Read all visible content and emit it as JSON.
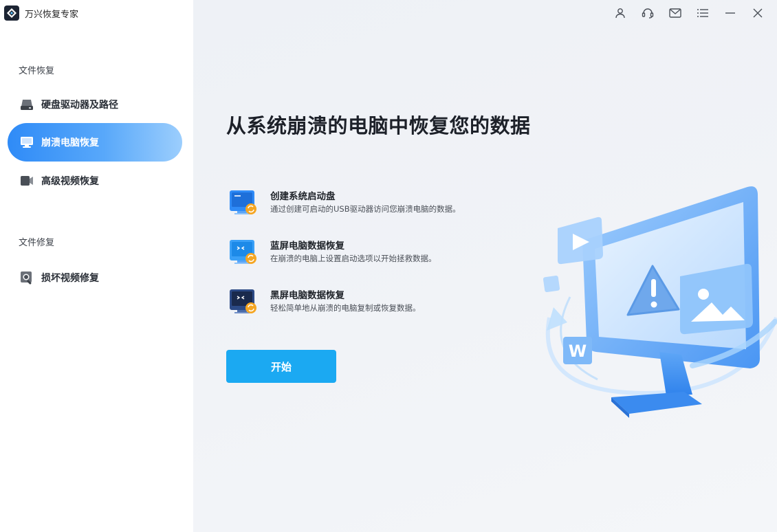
{
  "app": {
    "title": "万兴恢复专家"
  },
  "sidebar": {
    "sections": [
      {
        "label": "文件恢复",
        "items": [
          {
            "label": "硬盘驱动器及路径",
            "icon": "hard-drive-icon"
          },
          {
            "label": "崩溃电脑恢复",
            "icon": "monitor-icon",
            "active": true
          },
          {
            "label": "高级视频恢复",
            "icon": "video-camera-icon"
          }
        ]
      },
      {
        "label": "文件修复",
        "items": [
          {
            "label": "损坏视频修复",
            "icon": "video-repair-icon"
          }
        ]
      }
    ]
  },
  "window_controls": [
    "user-icon",
    "headset-icon",
    "mail-icon",
    "menu-icon",
    "minimize-icon",
    "close-icon"
  ],
  "main": {
    "headline": "从系统崩溃的电脑中恢复您的数据",
    "features": [
      {
        "title": "创建系统启动盘",
        "desc": "通过创建可启动的USB驱动器访问您崩溃电脑的数据。",
        "icon": "bootable-drive-icon"
      },
      {
        "title": "蓝屏电脑数据恢复",
        "desc": "在崩溃的电脑上设置启动选项以开始拯救数据。",
        "icon": "blue-screen-icon"
      },
      {
        "title": "黑屏电脑数据恢复",
        "desc": "轻松简单地从崩溃的电脑复制或恢复数据。",
        "icon": "black-screen-icon"
      }
    ],
    "start_label": "开始"
  },
  "colors": {
    "accent": "#2f8bf7",
    "button": "#1ba9f2",
    "background": "#eef1f6"
  }
}
